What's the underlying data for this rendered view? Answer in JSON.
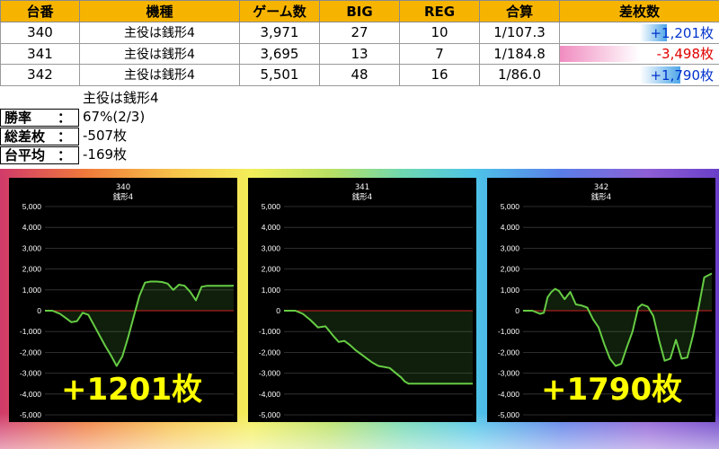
{
  "table": {
    "headers": [
      "台番",
      "機種",
      "ゲーム数",
      "BIG",
      "REG",
      "合算",
      "差枚数"
    ],
    "rows": [
      {
        "machine": "340",
        "model": "主役は銭形4",
        "games": "3,971",
        "big": "27",
        "reg": "10",
        "combined": "1/107.3",
        "diff": "+1,201枚",
        "diff_value": 1201
      },
      {
        "machine": "341",
        "model": "主役は銭形4",
        "games": "3,695",
        "big": "13",
        "reg": "7",
        "combined": "1/184.8",
        "diff": "-3,498枚",
        "diff_value": -3498
      },
      {
        "machine": "342",
        "model": "主役は銭形4",
        "games": "5,501",
        "big": "48",
        "reg": "16",
        "combined": "1/86.0",
        "diff": "+1,790枚",
        "diff_value": 1790
      }
    ]
  },
  "summary": {
    "title": "主役は銭形4",
    "rows": [
      {
        "label": "勝率",
        "colon": "：",
        "value": "67%(2/3)"
      },
      {
        "label": "総差枚",
        "colon": "：",
        "value": "-507枚"
      },
      {
        "label": "台平均",
        "colon": "：",
        "value": "-169枚"
      }
    ]
  },
  "colors": {
    "header_bg": "#f6b400",
    "positive_text": "#0033cc",
    "negative_text": "#e00000",
    "line": "#66cc44",
    "zero_line": "#cc2222",
    "overlay_text": "#ffff00"
  },
  "chart_data": [
    {
      "type": "line",
      "title": "340",
      "subtitle": "銭形4",
      "ylim": [
        -5000,
        5000
      ],
      "yticks": [
        "5,000",
        "4,000",
        "3,000",
        "2,000",
        "1,000",
        "0",
        "-1,000",
        "-2,000",
        "-3,000",
        "-4,000",
        "-5,000"
      ],
      "grid": true,
      "overlay": "+1201枚",
      "x": [
        0,
        4,
        8,
        11,
        14,
        17,
        20,
        23,
        26,
        29,
        32,
        35,
        38,
        41,
        44,
        47,
        50,
        53,
        56,
        59,
        62,
        65,
        68,
        71,
        74,
        77,
        80,
        83,
        86,
        89,
        92,
        95,
        98,
        100
      ],
      "y": [
        0,
        0,
        -150,
        -350,
        -550,
        -500,
        -100,
        -200,
        -700,
        -1200,
        -1700,
        -2150,
        -2650,
        -2200,
        -1300,
        -300,
        700,
        1350,
        1400,
        1400,
        1380,
        1300,
        1000,
        1250,
        1200,
        900,
        500,
        1150,
        1200,
        1200,
        1200,
        1200,
        1200,
        1201
      ]
    },
    {
      "type": "line",
      "title": "341",
      "subtitle": "銭形4",
      "ylim": [
        -5000,
        5000
      ],
      "yticks": [
        "5,000",
        "4,000",
        "3,000",
        "2,000",
        "1,000",
        "0",
        "-1,000",
        "-2,000",
        "-3,000",
        "-4,000",
        "-5,000"
      ],
      "grid": true,
      "x": [
        0,
        6,
        10,
        14,
        18,
        22,
        26,
        29,
        32,
        35,
        38,
        41,
        44,
        47,
        50,
        53,
        56,
        58,
        60,
        62,
        64,
        66,
        70,
        80,
        90,
        100
      ],
      "y": [
        0,
        0,
        -150,
        -450,
        -800,
        -750,
        -1200,
        -1500,
        -1450,
        -1650,
        -1900,
        -2100,
        -2300,
        -2500,
        -2650,
        -2700,
        -2750,
        -2900,
        -3050,
        -3200,
        -3400,
        -3500,
        -3498,
        -3498,
        -3498,
        -3498
      ]
    },
    {
      "type": "line",
      "title": "342",
      "subtitle": "銭形4",
      "ylim": [
        -5000,
        5000
      ],
      "yticks": [
        "5,000",
        "4,000",
        "3,000",
        "2,000",
        "1,000",
        "0",
        "-1,000",
        "-2,000",
        "-3,000",
        "-4,000",
        "-5,000"
      ],
      "grid": true,
      "overlay": "+1790枚",
      "x": [
        0,
        5,
        9,
        11,
        13,
        15,
        17,
        19,
        22,
        25,
        28,
        31,
        34,
        37,
        40,
        43,
        46,
        49,
        52,
        55,
        58,
        61,
        63,
        66,
        69,
        72,
        75,
        78,
        81,
        84,
        87,
        90,
        93,
        96,
        100
      ],
      "y": [
        0,
        0,
        -150,
        -100,
        650,
        900,
        1050,
        950,
        550,
        900,
        300,
        250,
        150,
        -400,
        -800,
        -1600,
        -2300,
        -2650,
        -2550,
        -1750,
        -1000,
        150,
        300,
        200,
        -250,
        -1400,
        -2400,
        -2300,
        -1400,
        -2300,
        -2250,
        -1200,
        150,
        1600,
        1790
      ]
    }
  ]
}
